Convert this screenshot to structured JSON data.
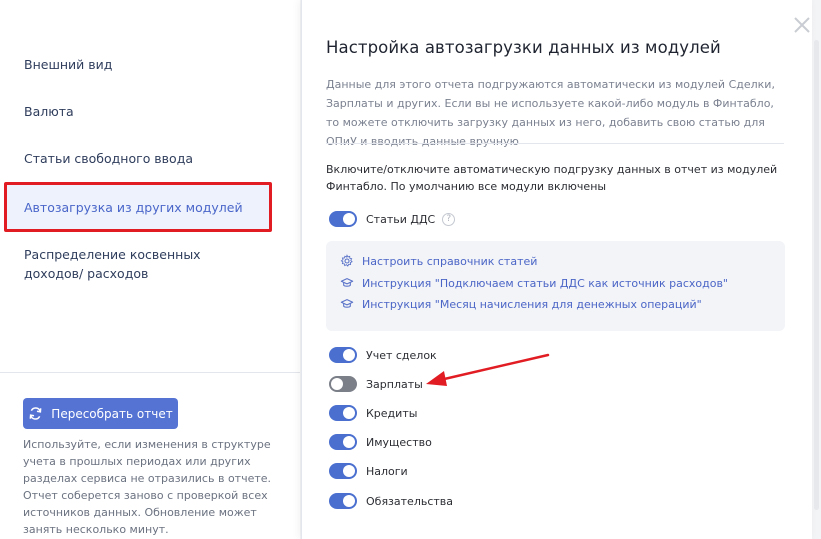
{
  "sidebar": {
    "items": [
      {
        "label": "Внешний вид"
      },
      {
        "label": "Валюта"
      },
      {
        "label": "Статьи свободного ввода"
      },
      {
        "label": "Автозагрузка из других модулей"
      },
      {
        "label": "Распределение косвенных доходов/ расходов"
      }
    ],
    "rebuild_button": "Пересобрать отчет",
    "rebuild_help": "Используйте, если изменения в структуре учета в прошлых периодах или других разделах сервиса не отразились в отчете. Отчет соберется заново с проверкой всех источников данных. Обновление может занять несколько минут."
  },
  "panel": {
    "title": "Настройка автозагрузки данных из модулей",
    "description": "Данные для этого отчета подгружаются автоматически из модулей Сделки, Зарплаты и других. Если вы не используете какой-либо модуль в Финтабло, то можете отключить загрузку данных из него, добавить свою статью для ОПиУ и вводить данные вручную",
    "intro": "Включите/отключите автоматическую подгрузку данных в отчет из модулей Финтабло. По умолчанию все модули включены",
    "dds_toggle": {
      "label": "Статьи ДДС",
      "on": true,
      "help": "?"
    },
    "links": [
      {
        "label": "Настроить справочник статей",
        "icon": "gear-icon"
      },
      {
        "label": "Инструкция \"Подключаем статьи ДДС как источник расходов\"",
        "icon": "graduation-cap-icon"
      },
      {
        "label": "Инструкция \"Месяц начисления для денежных операций\"",
        "icon": "graduation-cap-icon"
      }
    ],
    "modules": [
      {
        "label": "Учет сделок",
        "on": true
      },
      {
        "label": "Зарплаты",
        "on": false
      },
      {
        "label": "Кредиты",
        "on": true
      },
      {
        "label": "Имущество",
        "on": true
      },
      {
        "label": "Налоги",
        "on": true
      },
      {
        "label": "Обязательства",
        "on": true
      }
    ]
  },
  "colors": {
    "accent": "#4a6fcf",
    "highlight": "#e11d23",
    "toggle_off": "#7b7f88"
  }
}
